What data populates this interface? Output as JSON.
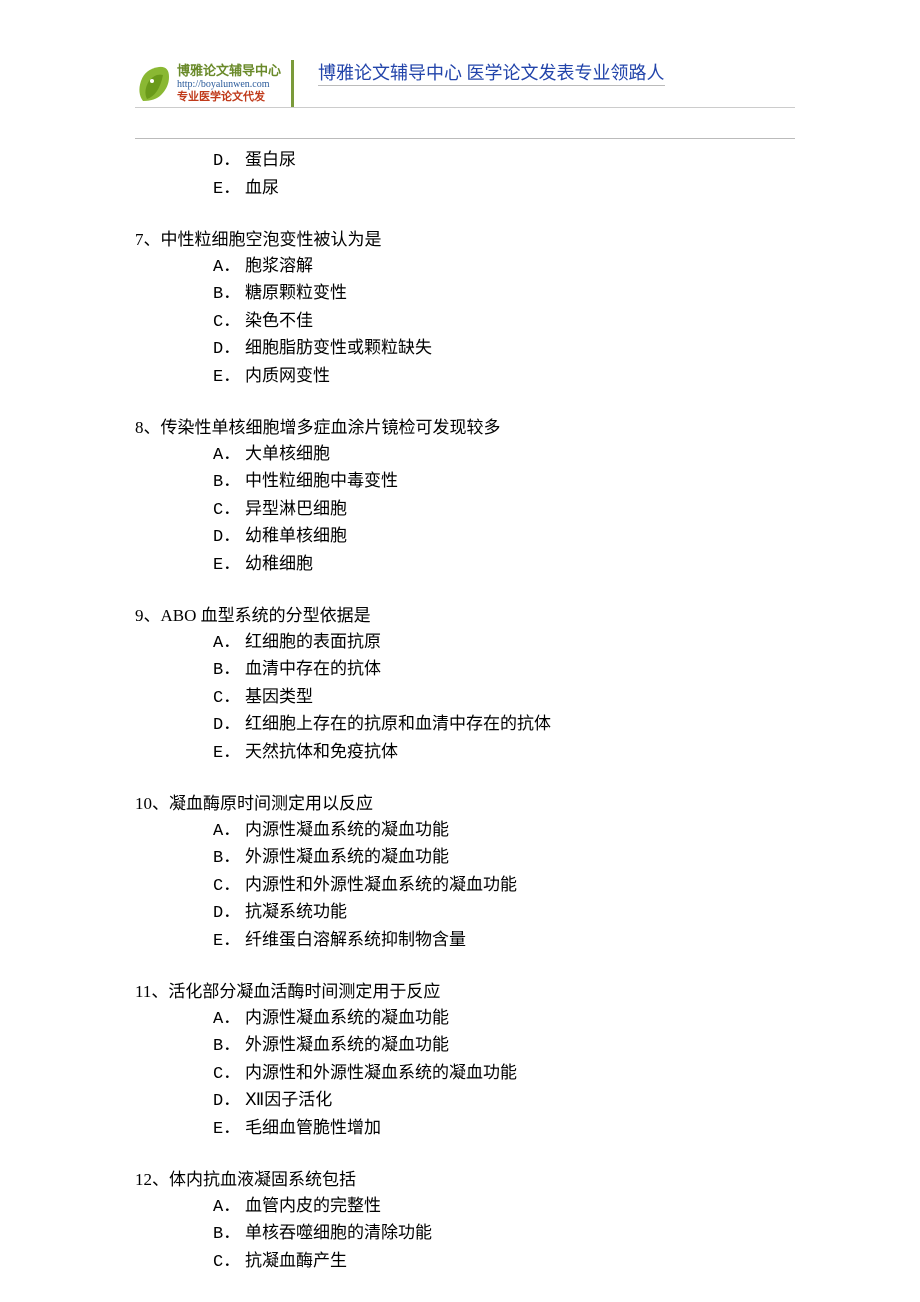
{
  "header": {
    "logo_title": "博雅论文辅导中心",
    "logo_url": "http://boyalunwen.com",
    "logo_sub": "专业医学论文代发",
    "right_text": "博雅论文辅导中心 医学论文发表专业领路人"
  },
  "orphan_options": [
    {
      "label": "D．",
      "text": "蛋白尿"
    },
    {
      "label": "E．",
      "text": "血尿"
    }
  ],
  "questions": [
    {
      "num": "7、",
      "stem": "中性粒细胞空泡变性被认为是",
      "options": [
        {
          "label": "A．",
          "text": "胞浆溶解"
        },
        {
          "label": "B．",
          "text": "糖原颗粒变性"
        },
        {
          "label": "C．",
          "text": "染色不佳"
        },
        {
          "label": "D．",
          "text": "细胞脂肪变性或颗粒缺失"
        },
        {
          "label": "E．",
          "text": "内质网变性"
        }
      ]
    },
    {
      "num": "8、",
      "stem": "传染性单核细胞增多症血涂片镜检可发现较多",
      "options": [
        {
          "label": "A．",
          "text": "大单核细胞"
        },
        {
          "label": "B．",
          "text": "中性粒细胞中毒变性"
        },
        {
          "label": "C．",
          "text": "异型淋巴细胞"
        },
        {
          "label": "D．",
          "text": "幼稚单核细胞"
        },
        {
          "label": "E．",
          "text": "幼稚细胞"
        }
      ]
    },
    {
      "num": "9、",
      "stem": "ABO 血型系统的分型依据是",
      "options": [
        {
          "label": "A．",
          "text": "红细胞的表面抗原"
        },
        {
          "label": "B．",
          "text": "血清中存在的抗体"
        },
        {
          "label": "C．",
          "text": "基因类型"
        },
        {
          "label": "D．",
          "text": "红细胞上存在的抗原和血清中存在的抗体"
        },
        {
          "label": "E．",
          "text": "天然抗体和免疫抗体"
        }
      ]
    },
    {
      "num": "10、",
      "stem": "凝血酶原时间测定用以反应",
      "options": [
        {
          "label": "A．",
          "text": "内源性凝血系统的凝血功能"
        },
        {
          "label": "B．",
          "text": "外源性凝血系统的凝血功能"
        },
        {
          "label": "C．",
          "text": "内源性和外源性凝血系统的凝血功能"
        },
        {
          "label": "D．",
          "text": "抗凝系统功能"
        },
        {
          "label": "E．",
          "text": "纤维蛋白溶解系统抑制物含量"
        }
      ]
    },
    {
      "num": "11、",
      "stem": "活化部分凝血活酶时间测定用于反应",
      "options": [
        {
          "label": "A．",
          "text": "内源性凝血系统的凝血功能"
        },
        {
          "label": "B．",
          "text": "外源性凝血系统的凝血功能"
        },
        {
          "label": "C．",
          "text": "内源性和外源性凝血系统的凝血功能"
        },
        {
          "label": "D．",
          "text": "Ⅻ因子活化"
        },
        {
          "label": "E．",
          "text": "毛细血管脆性增加"
        }
      ]
    },
    {
      "num": "12、",
      "stem": "体内抗血液凝固系统包括",
      "options": [
        {
          "label": "A．",
          "text": "血管内皮的完整性"
        },
        {
          "label": "B．",
          "text": "单核吞噬细胞的清除功能"
        },
        {
          "label": "C．",
          "text": "抗凝血酶产生"
        }
      ]
    }
  ]
}
